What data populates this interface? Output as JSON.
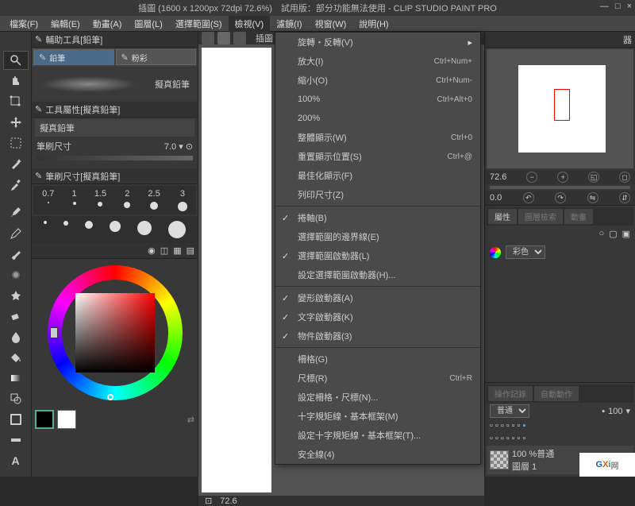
{
  "title": "插圖 (1600 x 1200px 72dpi 72.6%)　試用版：部分功能無法使用 - CLIP STUDIO PAINT PRO",
  "menus": [
    "檔案(F)",
    "編輯(E)",
    "動畫(A)",
    "圖層(L)",
    "選擇範圍(S)",
    "檢視(V)",
    "濾鏡(I)",
    "視窗(W)",
    "說明(H)"
  ],
  "subtool_header": "輔助工具[鉛筆]",
  "subtools": [
    {
      "label": "鉛筆",
      "sel": true
    },
    {
      "label": "粉彩",
      "sel": false
    }
  ],
  "brush_name": "擬真鉛筆",
  "tool_prop_header": "工具屬性[擬真鉛筆]",
  "tool_prop_name": "擬真鉛筆",
  "brush_size_label": "筆刷尺寸",
  "brush_size_value": "7.0",
  "size_header": "筆刷尺寸[擬真鉛筆]",
  "dots": [
    "0.7",
    "1",
    "1.5",
    "2",
    "2.5",
    "3"
  ],
  "canvas_tab": "插圖",
  "zoom_status": "72.6",
  "dropdown": [
    {
      "t": "item",
      "label": "旋轉・反轉(V)",
      "arrow": true
    },
    {
      "t": "item",
      "label": "放大(I)",
      "sc": "Ctrl+Num+"
    },
    {
      "t": "item",
      "label": "縮小(O)",
      "sc": "Ctrl+Num-"
    },
    {
      "t": "item",
      "label": "100%",
      "sc": "Ctrl+Alt+0"
    },
    {
      "t": "item",
      "label": "200%"
    },
    {
      "t": "item",
      "label": "整體顯示(W)",
      "sc": "Ctrl+0"
    },
    {
      "t": "item",
      "label": "重置顯示位置(S)",
      "sc": "Ctrl+@"
    },
    {
      "t": "item",
      "label": "最佳化顯示(F)"
    },
    {
      "t": "item",
      "label": "列印尺寸(Z)"
    },
    {
      "t": "sep"
    },
    {
      "t": "item",
      "label": "捲軸(B)",
      "check": true
    },
    {
      "t": "item",
      "label": "選擇範圍的邊界線(E)",
      "disabled": true
    },
    {
      "t": "item",
      "label": "選擇範圍啟動器(L)",
      "check": true
    },
    {
      "t": "item",
      "label": "設定選擇範圍啟動器(H)...",
      "disabled": true
    },
    {
      "t": "sep"
    },
    {
      "t": "item",
      "label": "變形啟動器(A)",
      "check": true
    },
    {
      "t": "item",
      "label": "文字啟動器(K)",
      "check": true
    },
    {
      "t": "item",
      "label": "物件啟動器(3)",
      "check": true
    },
    {
      "t": "sep"
    },
    {
      "t": "item",
      "label": "柵格(G)"
    },
    {
      "t": "item",
      "label": "尺標(R)",
      "sc": "Ctrl+R"
    },
    {
      "t": "item",
      "label": "設定柵格・尺標(N)..."
    },
    {
      "t": "item",
      "label": "十字規矩線・基本框架(M)",
      "disabled": true
    },
    {
      "t": "item",
      "label": "設定十字規矩線・基本框架(T)..."
    },
    {
      "t": "item",
      "label": "安全線(4)",
      "disabled": true
    }
  ],
  "nav_header": "器",
  "nav_zoom": "72.6",
  "nav_angle": "0.0",
  "rp_tab1": "屬性",
  "rp_tab2": "圖層檢索",
  "rp_tab3": "動畫",
  "color_mode": "彩色",
  "layer_tab1": "操作記錄",
  "layer_tab2": "自動動作",
  "blend_mode": "普通",
  "opacity": "100",
  "layer_opacity": "100 %",
  "layer_blend": "普通",
  "layer_name": "圖層 1",
  "watermark": {
    "g": "G",
    "x": "X",
    "i": "i",
    "net": "网"
  }
}
